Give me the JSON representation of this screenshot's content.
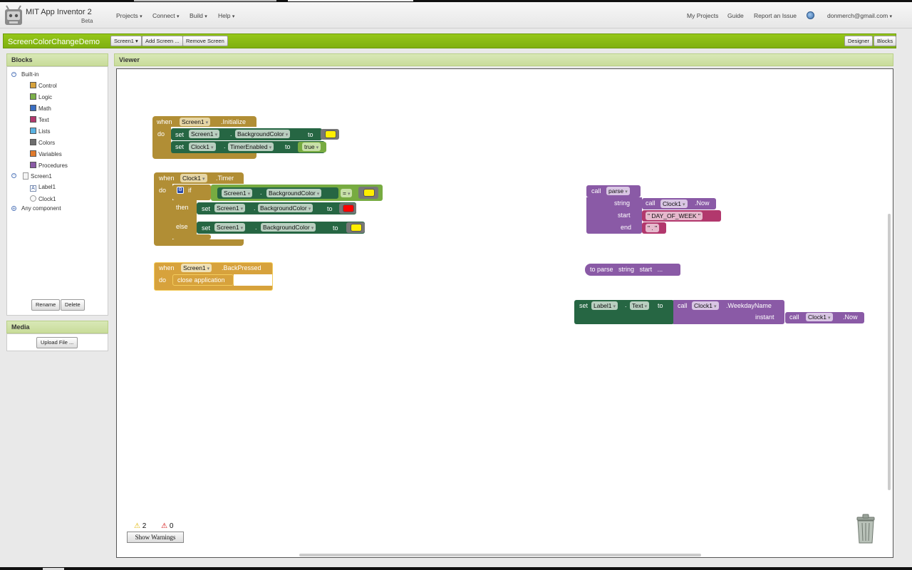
{
  "header": {
    "app_title": "MIT App Inventor 2",
    "beta": "Beta",
    "menus": [
      "Projects",
      "Connect",
      "Build",
      "Help"
    ],
    "right_links": [
      "My Projects",
      "Guide",
      "Report an Issue"
    ],
    "account": "donmerch@gmail.com"
  },
  "project_bar": {
    "project_name": "ScreenColorChangeDemo",
    "screen_select": "Screen1",
    "add_screen": "Add Screen ...",
    "remove_screen": "Remove Screen",
    "designer": "Designer",
    "blocks": "Blocks"
  },
  "blocks_panel": {
    "title": "Blocks",
    "builtin_label": "Built-in",
    "builtin": [
      {
        "label": "Control",
        "color": "#d7a23c"
      },
      {
        "label": "Logic",
        "color": "#7bb04a"
      },
      {
        "label": "Math",
        "color": "#3a6ec2"
      },
      {
        "label": "Text",
        "color": "#b2386d"
      },
      {
        "label": "Lists",
        "color": "#5ab2e2"
      },
      {
        "label": "Colors",
        "color": "#6d6d6d"
      },
      {
        "label": "Variables",
        "color": "#e07a2c"
      },
      {
        "label": "Procedures",
        "color": "#8a5aa6"
      }
    ],
    "screen_label": "Screen1",
    "components": [
      "Label1",
      "Clock1"
    ],
    "any_component": "Any component",
    "rename": "Rename",
    "delete": "Delete"
  },
  "media_panel": {
    "title": "Media",
    "upload": "Upload File ..."
  },
  "viewer": {
    "title": "Viewer",
    "warnings_count": "2",
    "errors_count": "0",
    "show_warnings": "Show Warnings"
  },
  "blocks": {
    "init": {
      "when": "when",
      "component": "Screen1",
      "event": ".Initialize",
      "do": "do",
      "set": "set",
      "dot": ".",
      "prop_bg": "BackgroundColor",
      "to": "to",
      "clock": "Clock1",
      "prop_timer": "TimerEnabled",
      "true_val": "true",
      "yellow": "#ffee00"
    },
    "timer": {
      "when": "when",
      "component": "Clock1",
      "event": ".Timer",
      "do": "do",
      "if": "if",
      "then": "then",
      "else": "else",
      "screen": "Screen1",
      "dot": ".",
      "prop_bg": "BackgroundColor",
      "eq": "=",
      "set": "set",
      "to": "to",
      "red": "#ff0000",
      "yellow": "#ffee00"
    },
    "back": {
      "when": "when",
      "component": "Screen1",
      "event": ".BackPressed",
      "do": "do",
      "close": "close application"
    },
    "call_parse": {
      "call": "call",
      "proc": "parse",
      "string": "string",
      "start": "start",
      "end": "end",
      "call2": "call",
      "clock": "Clock1",
      "now": ".Now",
      "start_text": "\" DAY_OF_WEEK \"",
      "end_text": "\" . \""
    },
    "to_parse": {
      "text": "to parse",
      "string": "string",
      "start": "start",
      "ellipsis": "..."
    },
    "set_label": {
      "set": "set",
      "label": "Label1",
      "dot": ".",
      "prop": "Text",
      "to": "to",
      "call": "call",
      "clock": "Clock1",
      "weekday": ".WeekdayName",
      "instant": "instant",
      "call2": "call",
      "now": ".Now"
    }
  }
}
